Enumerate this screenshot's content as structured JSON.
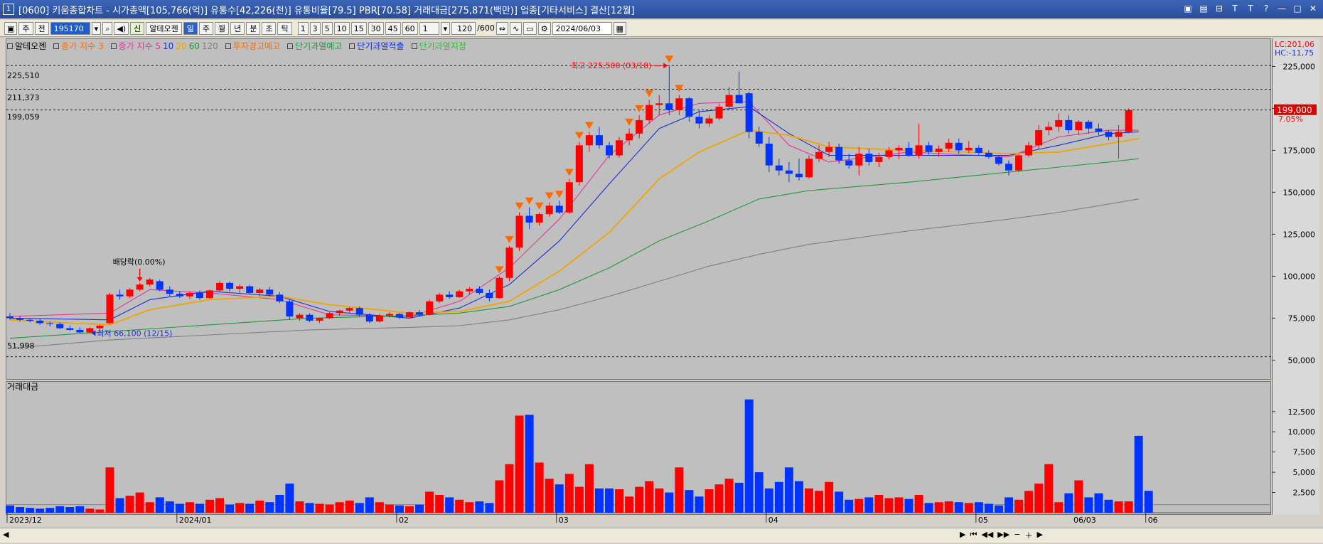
{
  "titlebar": {
    "icon": "1",
    "title": "[0600] 키움종합차트 - 시가총액[105,766(억)] 유통수[42,226(천)] 유통비율[79.5] PBR[70.58] 거래대금[275,871(백만)] 업종[기타서비스] 결산[12월]"
  },
  "toolbar": {
    "period": "주",
    "adjust": "전",
    "code": "195170",
    "stock_name": "알테오젠",
    "stock_badge": "신",
    "intervals": [
      "일",
      "주",
      "월",
      "년",
      "분",
      "초",
      "틱"
    ],
    "minutes": [
      "1",
      "3",
      "5",
      "10",
      "15",
      "30",
      "45",
      "60"
    ],
    "multiplier": "1",
    "count": "120",
    "count_total": "/600",
    "date": "2024/06/03"
  },
  "legend": {
    "stock": "알테오젠",
    "ma_label1": "종가 지수 3",
    "ma_label2": "종가 지수 5",
    "ma_periods": [
      "10",
      "20",
      "60",
      "120"
    ],
    "warn1": "투자경고예고",
    "warn2": "단기과열예고",
    "warn3": "단기과열적출",
    "warn4": "단기과열지정",
    "colors": {
      "ma3": "#ff6a00",
      "ma5": "#e0399a",
      "ma10": "#1b2fd1",
      "ma20": "#f0a500",
      "ma60": "#1f9a3c",
      "ma120": "#808080",
      "up": "#ff0000",
      "down": "#0033ff"
    }
  },
  "price_axis": {
    "ticks": [
      "225,000",
      "200,000",
      "175,000",
      "150,000",
      "125,000",
      "100,000",
      "75,000",
      "50,000"
    ],
    "lc": "LC:201,06",
    "hc": "HC:-11,75",
    "current_price": "199,000",
    "change_pct": "7.05%"
  },
  "levels": [
    "225,510",
    "211,373",
    "199,059",
    "51,998"
  ],
  "annotations": {
    "high": "최고 225,500 (03/18)",
    "low": "최저 66,100 (12/15)",
    "dividend": "배당락(0.00%)"
  },
  "volume_panel": {
    "title": "거래대금",
    "ticks": [
      "12,500",
      "10,000",
      "7,500",
      "5,000",
      "2,500"
    ]
  },
  "x_axis": {
    "labels": [
      "2023/12",
      "2024/01",
      "02",
      "03",
      "04",
      "05",
      "06"
    ],
    "right_label": "06/03"
  },
  "chart_data": {
    "type": "candlestick",
    "ylim": [
      40000,
      240000
    ],
    "candles": [
      {
        "o": 76000,
        "h": 78000,
        "l": 74000,
        "c": 75000
      },
      {
        "o": 75000,
        "h": 76500,
        "l": 73000,
        "c": 74000
      },
      {
        "o": 74000,
        "h": 75000,
        "l": 72500,
        "c": 73500
      },
      {
        "o": 73500,
        "h": 74500,
        "l": 71000,
        "c": 72000
      },
      {
        "o": 72000,
        "h": 73000,
        "l": 70000,
        "c": 71500
      },
      {
        "o": 71500,
        "h": 72500,
        "l": 68500,
        "c": 69000
      },
      {
        "o": 69000,
        "h": 70500,
        "l": 67500,
        "c": 68000
      },
      {
        "o": 68000,
        "h": 69500,
        "l": 66100,
        "c": 66500
      },
      {
        "o": 66500,
        "h": 69500,
        "l": 66100,
        "c": 69000
      },
      {
        "o": 69000,
        "h": 71000,
        "l": 68000,
        "c": 70500
      },
      {
        "o": 72000,
        "h": 90000,
        "l": 71500,
        "c": 89000
      },
      {
        "o": 89000,
        "h": 92000,
        "l": 86000,
        "c": 88000
      },
      {
        "o": 88000,
        "h": 93000,
        "l": 87000,
        "c": 92000
      },
      {
        "o": 92000,
        "h": 96000,
        "l": 91000,
        "c": 95000
      },
      {
        "o": 95000,
        "h": 99000,
        "l": 94000,
        "c": 98000
      },
      {
        "o": 97000,
        "h": 98000,
        "l": 91000,
        "c": 92000
      },
      {
        "o": 92000,
        "h": 94000,
        "l": 88000,
        "c": 89500
      },
      {
        "o": 89500,
        "h": 91000,
        "l": 87000,
        "c": 88000
      },
      {
        "o": 88000,
        "h": 91000,
        "l": 86500,
        "c": 90000
      },
      {
        "o": 90000,
        "h": 91500,
        "l": 86000,
        "c": 87000
      },
      {
        "o": 87000,
        "h": 92000,
        "l": 86500,
        "c": 91500
      },
      {
        "o": 91500,
        "h": 97000,
        "l": 91000,
        "c": 96000
      },
      {
        "o": 96000,
        "h": 97000,
        "l": 91000,
        "c": 92500
      },
      {
        "o": 92500,
        "h": 95000,
        "l": 89500,
        "c": 94000
      },
      {
        "o": 94000,
        "h": 95000,
        "l": 89000,
        "c": 90000
      },
      {
        "o": 90000,
        "h": 93000,
        "l": 88000,
        "c": 92000
      },
      {
        "o": 92000,
        "h": 93500,
        "l": 88000,
        "c": 89000
      },
      {
        "o": 89000,
        "h": 90500,
        "l": 84000,
        "c": 85000
      },
      {
        "o": 85000,
        "h": 86000,
        "l": 74000,
        "c": 76000
      },
      {
        "o": 75000,
        "h": 78000,
        "l": 73500,
        "c": 77000
      },
      {
        "o": 77000,
        "h": 78000,
        "l": 72500,
        "c": 73500
      },
      {
        "o": 73500,
        "h": 75500,
        "l": 72000,
        "c": 75000
      },
      {
        "o": 75000,
        "h": 78500,
        "l": 74500,
        "c": 78000
      },
      {
        "o": 78000,
        "h": 80000,
        "l": 76500,
        "c": 79500
      },
      {
        "o": 79500,
        "h": 81500,
        "l": 78000,
        "c": 81000
      },
      {
        "o": 81000,
        "h": 82000,
        "l": 76000,
        "c": 77000
      },
      {
        "o": 77000,
        "h": 78000,
        "l": 72000,
        "c": 73000
      },
      {
        "o": 73000,
        "h": 77500,
        "l": 72500,
        "c": 76500
      },
      {
        "o": 76500,
        "h": 78500,
        "l": 75500,
        "c": 77500
      },
      {
        "o": 77500,
        "h": 78000,
        "l": 74500,
        "c": 75500
      },
      {
        "o": 75500,
        "h": 79000,
        "l": 75000,
        "c": 78500
      },
      {
        "o": 78500,
        "h": 80000,
        "l": 76000,
        "c": 77000
      },
      {
        "o": 77000,
        "h": 86000,
        "l": 76500,
        "c": 85000
      },
      {
        "o": 85000,
        "h": 90000,
        "l": 84000,
        "c": 89000
      },
      {
        "o": 89000,
        "h": 91000,
        "l": 86500,
        "c": 87500
      },
      {
        "o": 87500,
        "h": 92000,
        "l": 87000,
        "c": 91000
      },
      {
        "o": 91000,
        "h": 93500,
        "l": 89000,
        "c": 92500
      },
      {
        "o": 92500,
        "h": 94000,
        "l": 89000,
        "c": 90000
      },
      {
        "o": 90000,
        "h": 92000,
        "l": 85000,
        "c": 87000
      },
      {
        "o": 87000,
        "h": 100000,
        "l": 86500,
        "c": 99000
      },
      {
        "o": 99000,
        "h": 118000,
        "l": 97000,
        "c": 117000
      },
      {
        "o": 117000,
        "h": 138000,
        "l": 115000,
        "c": 136000
      },
      {
        "o": 136000,
        "h": 141000,
        "l": 128000,
        "c": 132000
      },
      {
        "o": 132000,
        "h": 138000,
        "l": 130000,
        "c": 137000
      },
      {
        "o": 137000,
        "h": 144000,
        "l": 135500,
        "c": 142000
      },
      {
        "o": 142000,
        "h": 145000,
        "l": 137000,
        "c": 138000
      },
      {
        "o": 138000,
        "h": 158000,
        "l": 137000,
        "c": 156000
      },
      {
        "o": 156000,
        "h": 180000,
        "l": 154000,
        "c": 178000
      },
      {
        "o": 178000,
        "h": 186000,
        "l": 174000,
        "c": 184000
      },
      {
        "o": 184000,
        "h": 189000,
        "l": 176000,
        "c": 178000
      },
      {
        "o": 178000,
        "h": 180000,
        "l": 170000,
        "c": 172000
      },
      {
        "o": 172000,
        "h": 183000,
        "l": 170500,
        "c": 181000
      },
      {
        "o": 181000,
        "h": 188000,
        "l": 178000,
        "c": 185000
      },
      {
        "o": 185000,
        "h": 196000,
        "l": 182000,
        "c": 193000
      },
      {
        "o": 193000,
        "h": 205000,
        "l": 191000,
        "c": 202000
      },
      {
        "o": 202000,
        "h": 208000,
        "l": 196000,
        "c": 203000
      },
      {
        "o": 203000,
        "h": 225500,
        "l": 196000,
        "c": 199000
      },
      {
        "o": 199000,
        "h": 208000,
        "l": 196000,
        "c": 206000
      },
      {
        "o": 206000,
        "h": 207000,
        "l": 192000,
        "c": 195000
      },
      {
        "o": 195000,
        "h": 199000,
        "l": 188000,
        "c": 191000
      },
      {
        "o": 191000,
        "h": 196000,
        "l": 189000,
        "c": 194000
      },
      {
        "o": 194000,
        "h": 203000,
        "l": 193000,
        "c": 201000
      },
      {
        "o": 201000,
        "h": 213000,
        "l": 199000,
        "c": 208000
      },
      {
        "o": 208000,
        "h": 222000,
        "l": 204000,
        "c": 203000
      },
      {
        "o": 209000,
        "h": 210000,
        "l": 182000,
        "c": 186000
      },
      {
        "o": 186000,
        "h": 189000,
        "l": 177000,
        "c": 179000
      },
      {
        "o": 179000,
        "h": 183000,
        "l": 162000,
        "c": 166000
      },
      {
        "o": 166000,
        "h": 170000,
        "l": 160000,
        "c": 163000
      },
      {
        "o": 163000,
        "h": 168000,
        "l": 156000,
        "c": 161000
      },
      {
        "o": 161000,
        "h": 170000,
        "l": 157000,
        "c": 159000
      },
      {
        "o": 159000,
        "h": 172000,
        "l": 158000,
        "c": 170000
      },
      {
        "o": 170000,
        "h": 178000,
        "l": 168000,
        "c": 174000
      },
      {
        "o": 174000,
        "h": 180000,
        "l": 171000,
        "c": 177000
      },
      {
        "o": 177000,
        "h": 179000,
        "l": 167000,
        "c": 169000
      },
      {
        "o": 169000,
        "h": 173000,
        "l": 164000,
        "c": 166000
      },
      {
        "o": 166000,
        "h": 177000,
        "l": 160000,
        "c": 173000
      },
      {
        "o": 173000,
        "h": 176000,
        "l": 166000,
        "c": 168000
      },
      {
        "o": 168000,
        "h": 173500,
        "l": 165000,
        "c": 171000
      },
      {
        "o": 171000,
        "h": 177000,
        "l": 169500,
        "c": 175000
      },
      {
        "o": 175000,
        "h": 178000,
        "l": 170000,
        "c": 176500
      },
      {
        "o": 176500,
        "h": 180000,
        "l": 171000,
        "c": 172000
      },
      {
        "o": 172000,
        "h": 191000,
        "l": 170000,
        "c": 178000
      },
      {
        "o": 178000,
        "h": 180000,
        "l": 172500,
        "c": 174000
      },
      {
        "o": 174000,
        "h": 178000,
        "l": 171000,
        "c": 176000
      },
      {
        "o": 176000,
        "h": 182000,
        "l": 174000,
        "c": 179500
      },
      {
        "o": 179500,
        "h": 182000,
        "l": 173000,
        "c": 175000
      },
      {
        "o": 175000,
        "h": 180500,
        "l": 173500,
        "c": 176500
      },
      {
        "o": 176500,
        "h": 178000,
        "l": 172000,
        "c": 173500
      },
      {
        "o": 173500,
        "h": 175000,
        "l": 170000,
        "c": 171000
      },
      {
        "o": 171000,
        "h": 172000,
        "l": 166000,
        "c": 167000
      },
      {
        "o": 167000,
        "h": 169000,
        "l": 160000,
        "c": 163000
      },
      {
        "o": 163000,
        "h": 173000,
        "l": 162000,
        "c": 172000
      },
      {
        "o": 172000,
        "h": 180000,
        "l": 171000,
        "c": 178000
      },
      {
        "o": 178000,
        "h": 190000,
        "l": 176000,
        "c": 187000
      },
      {
        "o": 187000,
        "h": 192000,
        "l": 184000,
        "c": 189000
      },
      {
        "o": 189000,
        "h": 197000,
        "l": 186000,
        "c": 193000
      },
      {
        "o": 193000,
        "h": 196000,
        "l": 185000,
        "c": 187000
      },
      {
        "o": 187000,
        "h": 193000,
        "l": 184000,
        "c": 192000
      },
      {
        "o": 192000,
        "h": 193000,
        "l": 185000,
        "c": 188000
      },
      {
        "o": 188000,
        "h": 191000,
        "l": 184000,
        "c": 186000
      },
      {
        "o": 186000,
        "h": 187000,
        "l": 181000,
        "c": 183000
      },
      {
        "o": 183000,
        "h": 190000,
        "l": 170000,
        "c": 186000
      },
      {
        "o": 186000,
        "h": 200000,
        "l": 185000,
        "c": 199000
      }
    ],
    "ma": {
      "ma5": [
        [
          0,
          76000
        ],
        [
          10,
          78000
        ],
        [
          14,
          92000
        ],
        [
          20,
          90000
        ],
        [
          27,
          86000
        ],
        [
          32,
          77000
        ],
        [
          40,
          76000
        ],
        [
          45,
          85000
        ],
        [
          50,
          105000
        ],
        [
          55,
          134000
        ],
        [
          60,
          172000
        ],
        [
          65,
          196000
        ],
        [
          69,
          203000
        ],
        [
          74,
          204000
        ],
        [
          78,
          178000
        ],
        [
          82,
          168000
        ],
        [
          90,
          174000
        ],
        [
          100,
          171000
        ],
        [
          105,
          183000
        ],
        [
          110,
          187000
        ],
        [
          113,
          187000
        ]
      ],
      "ma10": [
        [
          0,
          75000
        ],
        [
          10,
          74000
        ],
        [
          14,
          86000
        ],
        [
          20,
          91000
        ],
        [
          27,
          88000
        ],
        [
          32,
          79000
        ],
        [
          40,
          75000
        ],
        [
          45,
          81000
        ],
        [
          50,
          95000
        ],
        [
          55,
          121000
        ],
        [
          60,
          155000
        ],
        [
          65,
          188000
        ],
        [
          69,
          198000
        ],
        [
          74,
          201000
        ],
        [
          78,
          185000
        ],
        [
          82,
          172000
        ],
        [
          90,
          172000
        ],
        [
          100,
          172000
        ],
        [
          105,
          178000
        ],
        [
          110,
          185000
        ],
        [
          113,
          186000
        ]
      ],
      "ma20": [
        [
          0,
          74000
        ],
        [
          10,
          71000
        ],
        [
          14,
          80000
        ],
        [
          20,
          86000
        ],
        [
          27,
          88000
        ],
        [
          32,
          83000
        ],
        [
          40,
          78000
        ],
        [
          45,
          79000
        ],
        [
          50,
          85000
        ],
        [
          55,
          103000
        ],
        [
          60,
          126000
        ],
        [
          65,
          158000
        ],
        [
          69,
          174000
        ],
        [
          74,
          187000
        ],
        [
          78,
          184000
        ],
        [
          82,
          177000
        ],
        [
          90,
          175000
        ],
        [
          100,
          173000
        ],
        [
          105,
          174000
        ],
        [
          110,
          179000
        ],
        [
          113,
          182000
        ]
      ],
      "ma60": [
        [
          0,
          63000
        ],
        [
          10,
          67000
        ],
        [
          20,
          71000
        ],
        [
          30,
          75000
        ],
        [
          40,
          76500
        ],
        [
          45,
          78000
        ],
        [
          50,
          82000
        ],
        [
          55,
          92000
        ],
        [
          60,
          105000
        ],
        [
          65,
          121000
        ],
        [
          70,
          133000
        ],
        [
          75,
          146000
        ],
        [
          80,
          151000
        ],
        [
          90,
          156000
        ],
        [
          100,
          162000
        ],
        [
          105,
          165000
        ],
        [
          110,
          168000
        ],
        [
          113,
          170000
        ]
      ],
      "ma120": [
        [
          0,
          57000
        ],
        [
          10,
          62000
        ],
        [
          20,
          65000
        ],
        [
          30,
          68000
        ],
        [
          40,
          69500
        ],
        [
          45,
          70500
        ],
        [
          50,
          74000
        ],
        [
          55,
          80000
        ],
        [
          60,
          88000
        ],
        [
          65,
          97000
        ],
        [
          70,
          106000
        ],
        [
          75,
          113000
        ],
        [
          80,
          119000
        ],
        [
          90,
          127000
        ],
        [
          100,
          134000
        ],
        [
          105,
          138000
        ],
        [
          110,
          143000
        ],
        [
          113,
          146000
        ]
      ]
    },
    "volume": [
      0.9,
      0.7,
      0.6,
      0.5,
      0.6,
      0.8,
      0.7,
      0.8,
      0.5,
      0.4,
      5.6,
      1.8,
      2.1,
      2.5,
      1.3,
      1.9,
      1.4,
      1.1,
      1.3,
      1.1,
      1.6,
      1.8,
      1.0,
      1.2,
      1.1,
      1.5,
      1.3,
      2.2,
      3.6,
      1.4,
      1.2,
      1.1,
      1.0,
      1.3,
      1.5,
      1.2,
      1.9,
      1.3,
      1.0,
      0.9,
      0.8,
      1.0,
      2.6,
      2.2,
      1.9,
      1.6,
      1.3,
      1.4,
      1.2,
      4.0,
      6.0,
      12.0,
      12.1,
      6.2,
      4.2,
      3.5,
      4.8,
      3.2,
      6.0,
      3.0,
      3.0,
      2.9,
      2.0,
      3.2,
      3.9,
      3.0,
      2.5,
      5.6,
      2.8,
      2.0,
      2.9,
      3.5,
      4.2,
      3.7,
      14.0,
      5.0,
      3.0,
      3.8,
      5.6,
      3.9,
      3.0,
      2.7,
      3.8,
      2.6,
      1.6,
      1.7,
      1.9,
      2.2,
      1.8,
      1.9,
      1.7,
      2.2,
      1.2,
      1.3,
      1.4,
      1.3,
      1.2,
      1.3,
      1.1,
      0.9,
      1.9,
      1.6,
      2.7,
      3.6,
      6.0,
      1.3,
      2.4,
      4.0,
      1.9,
      2.4,
      1.6,
      1.4,
      1.4,
      9.5,
      2.7
    ],
    "volume_ylim": [
      0,
      14500
    ],
    "markers": {
      "down_arrows": [
        49,
        50,
        51,
        52,
        53,
        54,
        55,
        56,
        57,
        58,
        62,
        63,
        64,
        66,
        67
      ],
      "dividend_index": 13,
      "high_index": 66,
      "low_index": 8
    }
  }
}
